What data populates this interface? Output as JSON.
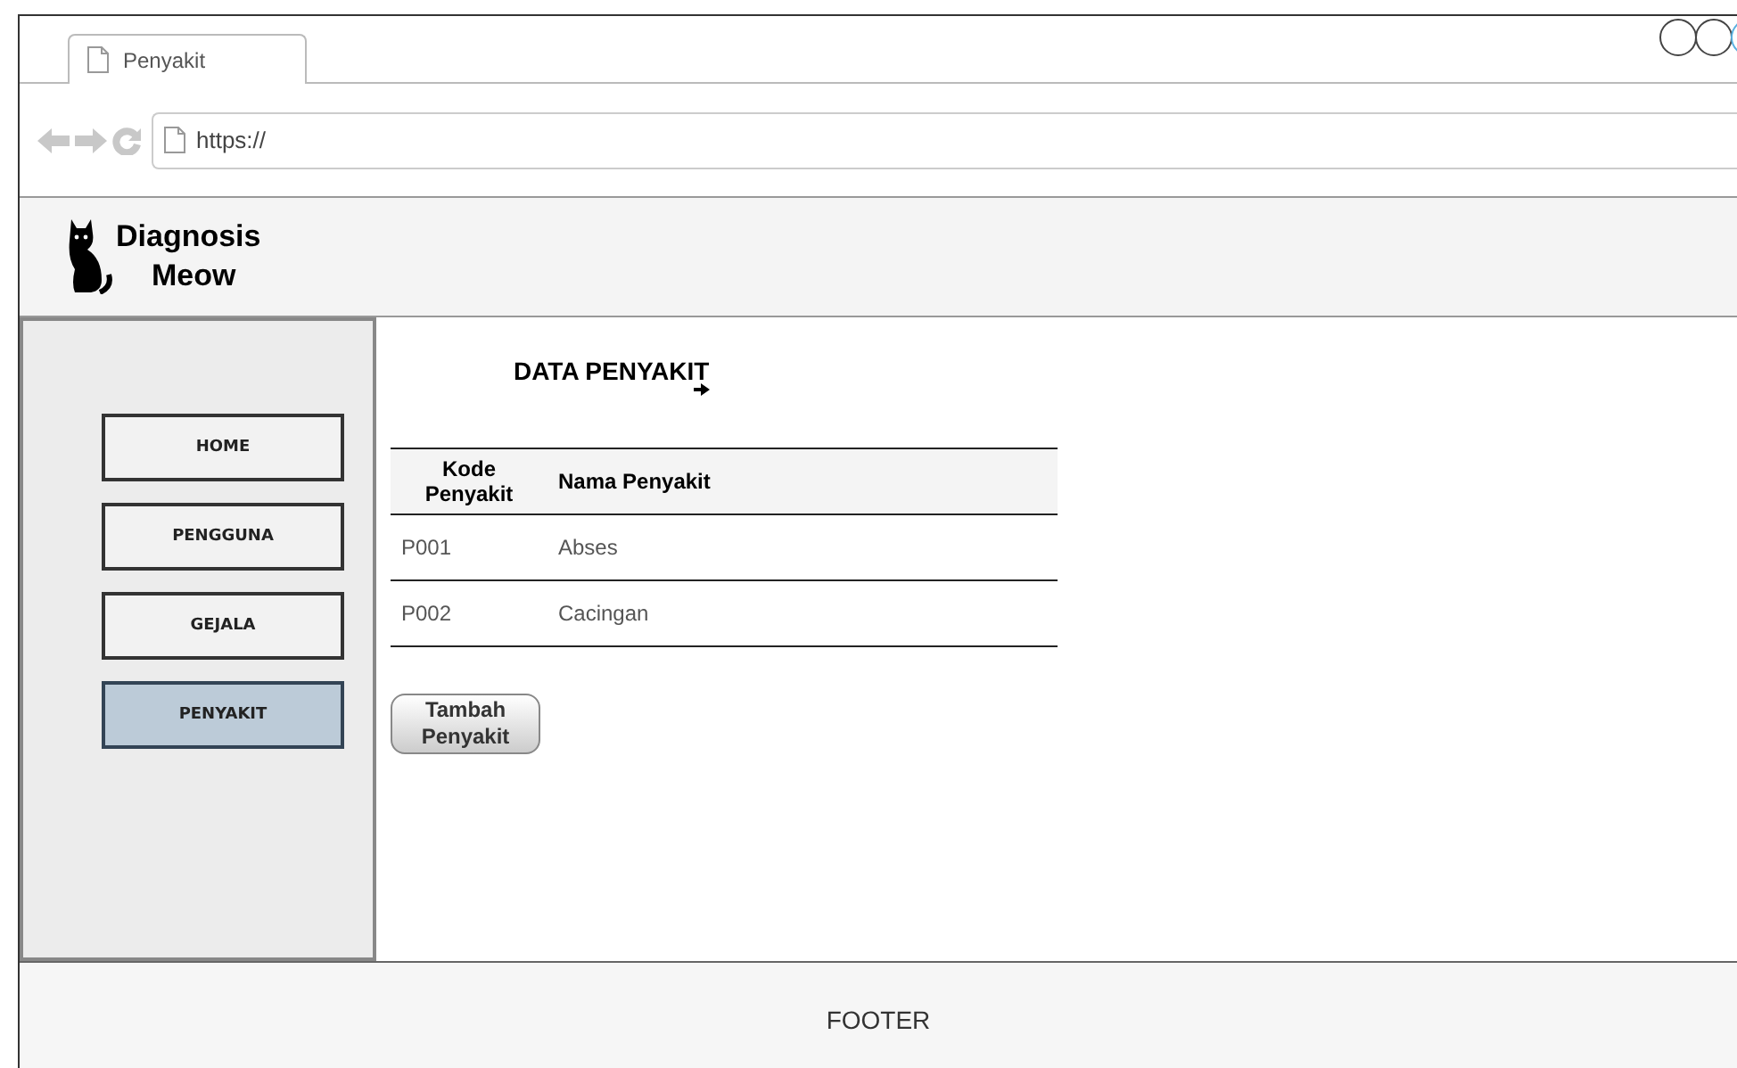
{
  "browser": {
    "tab_title": "Penyakit",
    "url": "https://"
  },
  "header": {
    "logo_line_1": "Diagnosis",
    "logo_line_2": "Meow"
  },
  "sidebar": {
    "items": [
      {
        "label": "HOME",
        "selected": false
      },
      {
        "label": "PENGGUNA",
        "selected": false
      },
      {
        "label": "GEJALA",
        "selected": false
      },
      {
        "label": "PENYAKIT",
        "selected": true
      }
    ]
  },
  "content": {
    "title": "DATA PENYAKIT",
    "table": {
      "columns": [
        "Kode Penyakit",
        "Nama Penyakit"
      ],
      "rows": [
        {
          "cells": [
            "P001",
            "Abses"
          ]
        },
        {
          "cells": [
            "P002",
            "Cacingan"
          ]
        }
      ]
    },
    "add_button": "Tambah Penyakit"
  },
  "footer": {
    "text": "FOOTER"
  }
}
